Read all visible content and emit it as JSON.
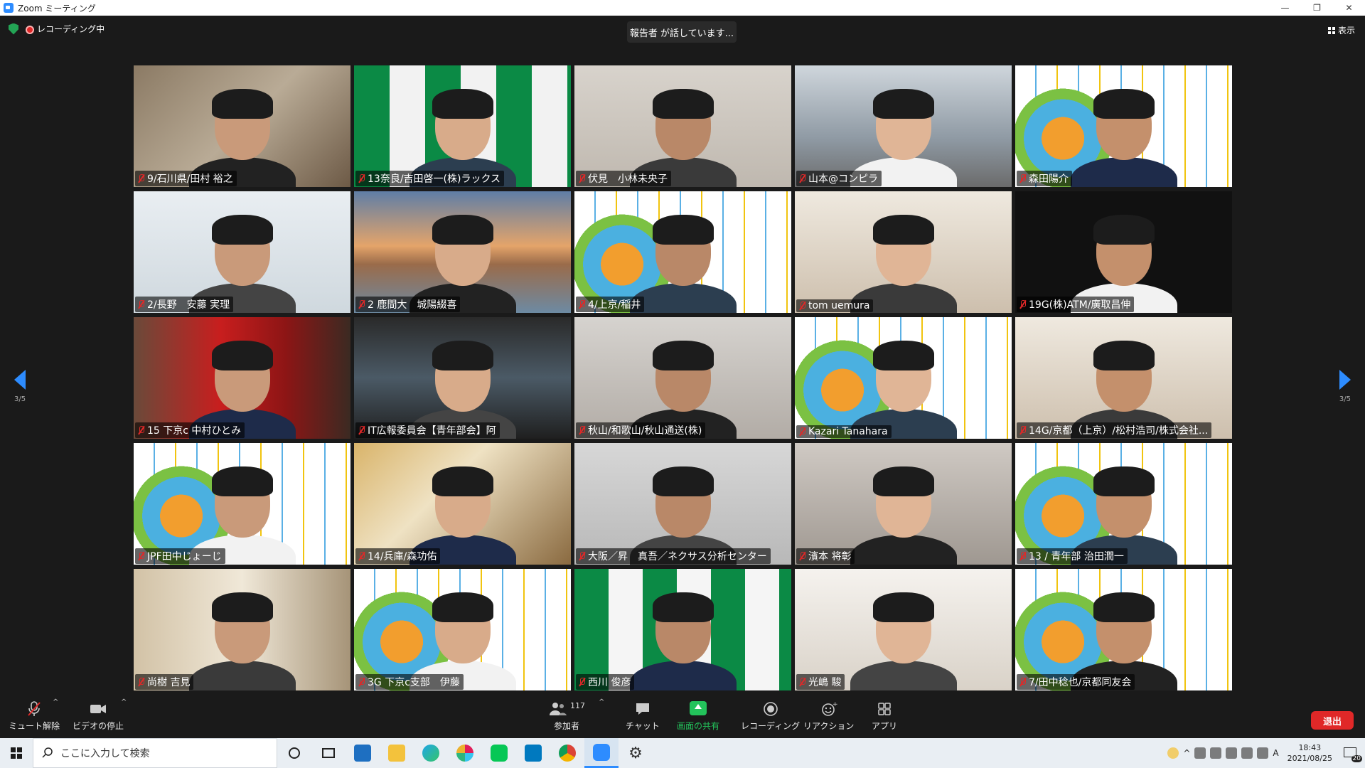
{
  "window": {
    "title": "Zoom ミーティング",
    "controls": [
      "—",
      "❐",
      "✕"
    ]
  },
  "top": {
    "recording_label": "レコーディング中",
    "speaker_text": "報告者 が話しています...",
    "view_label": "表示"
  },
  "pagination": {
    "left": "3/5",
    "right": "3/5"
  },
  "participants": [
    {
      "name": "9/石川県/田村 裕之",
      "bg": "office"
    },
    {
      "name": "13奈良/吉田啓一(株)ラックス",
      "bg": "green"
    },
    {
      "name": "伏見　小林未央子",
      "bg": "wall"
    },
    {
      "name": "山本@コンピラ",
      "bg": "city"
    },
    {
      "name": "森田陽介",
      "bg": "vision"
    },
    {
      "name": "2/長野　安藤 実理",
      "bg": "dancer"
    },
    {
      "name": "2 鹿間大　城陽綴喜",
      "bg": "bridge"
    },
    {
      "name": "4/上京/稲井",
      "bg": "vision"
    },
    {
      "name": "tom uemura",
      "bg": "room"
    },
    {
      "name": "19G(株)ATM/廣取昌伸",
      "bg": "dark"
    },
    {
      "name": "15 下京c 中村ひとみ",
      "bg": "red"
    },
    {
      "name": "IT広報委員会【青年部会】阿",
      "bg": "car"
    },
    {
      "name": "秋山/和歌山/秋山通送(株)",
      "bg": "grey"
    },
    {
      "name": "Kazari Tanahara",
      "bg": "vision"
    },
    {
      "name": "14G/京都（上京）/松村浩司/株式会社...",
      "bg": "room"
    },
    {
      "name": "JPF田中じょーじ",
      "bg": "vision"
    },
    {
      "name": "14/兵庫/森功佑",
      "bg": "blurwarm"
    },
    {
      "name": "大阪／昇　真吾／ネクサス分析センター",
      "bg": "chair"
    },
    {
      "name": "濱本 将彰",
      "bg": "hall"
    },
    {
      "name": "13 / 青年部 治田潤一",
      "bg": "vision"
    },
    {
      "name": "尚樹 吉見",
      "bg": "arm"
    },
    {
      "name": "3G 下京c支部　伊藤",
      "bg": "vision"
    },
    {
      "name": "西川 俊彦",
      "bg": "greenlogo"
    },
    {
      "name": "光嶋 駿",
      "bg": "whiteroom"
    },
    {
      "name": "7/田中稔也/京都同友会",
      "bg": "vision"
    }
  ],
  "toolbar": {
    "mute_label": "ミュート解除",
    "video_label": "ビデオの停止",
    "participants_label": "参加者",
    "participants_count": "117",
    "chat_label": "チャット",
    "share_label": "画面の共有",
    "record_label": "レコーディング",
    "reaction_label": "リアクション",
    "apps_label": "アプリ",
    "leave_label": "退出"
  },
  "taskbar": {
    "search_placeholder": "ここに入力して検索",
    "time": "18:43",
    "date": "2021/08/25",
    "ime": "A",
    "notification_count": "20"
  },
  "colors": {
    "accent": "#2d8cff",
    "leave": "#e02828",
    "share": "#23c35b",
    "bg": "#1a1a1a"
  }
}
